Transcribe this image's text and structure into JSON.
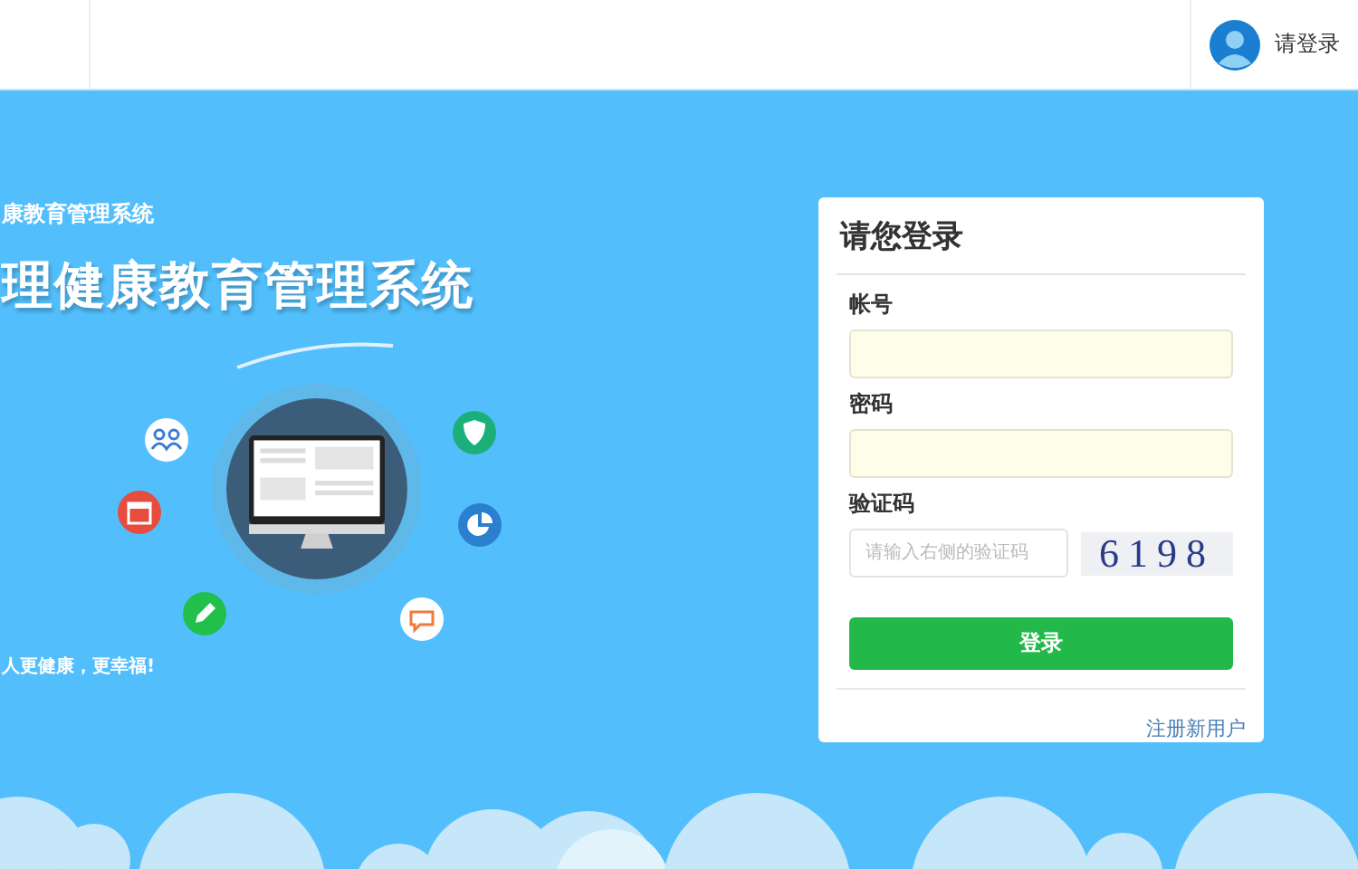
{
  "header": {
    "user_label": "请登录"
  },
  "banner": {
    "subtitle": "康教育管理系统",
    "title": "理健康教育管理系统",
    "slogan": "人更健康，更幸福!"
  },
  "login": {
    "title": "请您登录",
    "fields": [
      {
        "label": "帐号",
        "kind": "text"
      },
      {
        "label": "密码",
        "kind": "password"
      },
      {
        "label": "验证码",
        "kind": "captcha",
        "placeholder": "请输入右侧的验证码",
        "captcha_text": "6198"
      }
    ],
    "submit": "登录",
    "register_link": "注册新用户"
  }
}
